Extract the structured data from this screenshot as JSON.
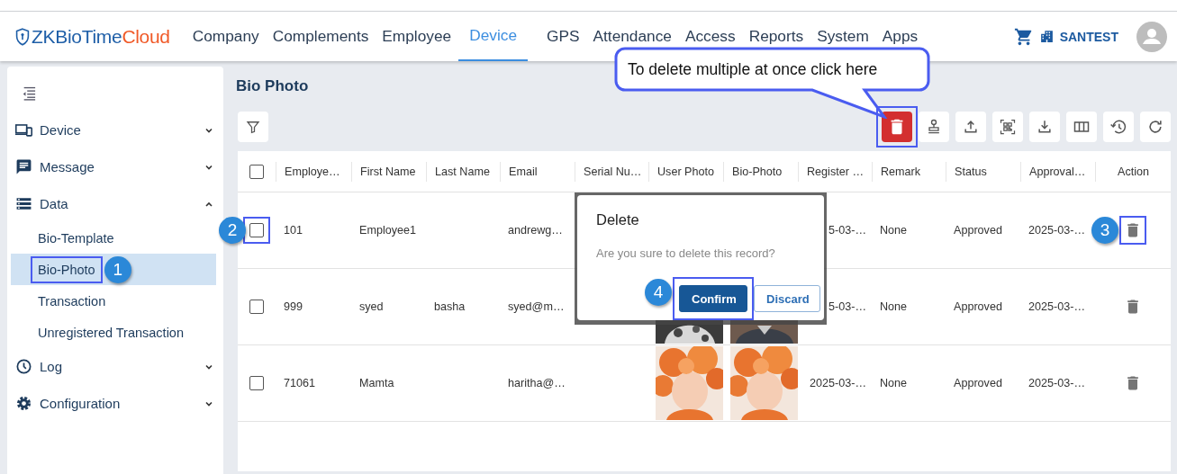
{
  "header": {
    "logo": {
      "text": "ZKBioTime",
      "accent": "Cloud"
    },
    "nav": [
      {
        "label": "Company",
        "selected": false
      },
      {
        "label": "Complements",
        "selected": false
      },
      {
        "label": "Employee",
        "selected": false
      },
      {
        "label": "Device",
        "selected": true
      },
      {
        "label": "GPS",
        "selected": false
      },
      {
        "label": "Attendance",
        "selected": false
      },
      {
        "label": "Access",
        "selected": false
      },
      {
        "label": "Reports",
        "selected": false
      },
      {
        "label": "System",
        "selected": false
      },
      {
        "label": "Apps",
        "selected": false
      }
    ],
    "account": "SANTEST"
  },
  "sidebar": {
    "groups": [
      {
        "label": "Device",
        "expanded": false
      },
      {
        "label": "Message",
        "expanded": false
      },
      {
        "label": "Data",
        "expanded": true,
        "children": [
          {
            "label": "Bio-Template",
            "selected": false
          },
          {
            "label": "Bio-Photo",
            "selected": true
          },
          {
            "label": "Transaction",
            "selected": false
          },
          {
            "label": "Unregistered Transaction",
            "selected": false
          }
        ]
      },
      {
        "label": "Log",
        "expanded": false
      },
      {
        "label": "Configuration",
        "expanded": false
      }
    ]
  },
  "page": {
    "title": "Bio Photo"
  },
  "table": {
    "select_all_checked": false,
    "columns": [
      "Employe…",
      "First Name",
      "Last Name",
      "Email",
      "Serial Nu…",
      "User Photo",
      "Bio-Photo",
      "Register …",
      "Remark",
      "Status",
      "Approval…",
      "Action"
    ],
    "rows": [
      {
        "checked": false,
        "id": "101",
        "first_name": "Employee1",
        "email": "andrewg…",
        "register": "5-03-…",
        "remark": "None",
        "status": "Approved",
        "approval": "2025-03-…"
      },
      {
        "checked": false,
        "id": "999",
        "first_name": "syed",
        "last_name": "basha",
        "email": "syed@m…",
        "register": "5-03-…",
        "remark": "None",
        "status": "Approved",
        "approval": "2025-03-…"
      },
      {
        "checked": false,
        "id": "71061",
        "first_name": "Mamta",
        "email": "haritha@…",
        "register": "2025-03-…",
        "remark": "None",
        "status": "Approved",
        "approval": "2025-03-…"
      }
    ]
  },
  "dialog": {
    "title": "Delete",
    "message": "Are you sure to delete this record?",
    "buttons": [
      {
        "label": "Confirm",
        "kind": "primary"
      },
      {
        "label": "Discard",
        "kind": "secondary"
      }
    ]
  },
  "annotations": {
    "callout": "To delete multiple at once click here",
    "steps": [
      "1",
      "2",
      "3",
      "4"
    ]
  }
}
